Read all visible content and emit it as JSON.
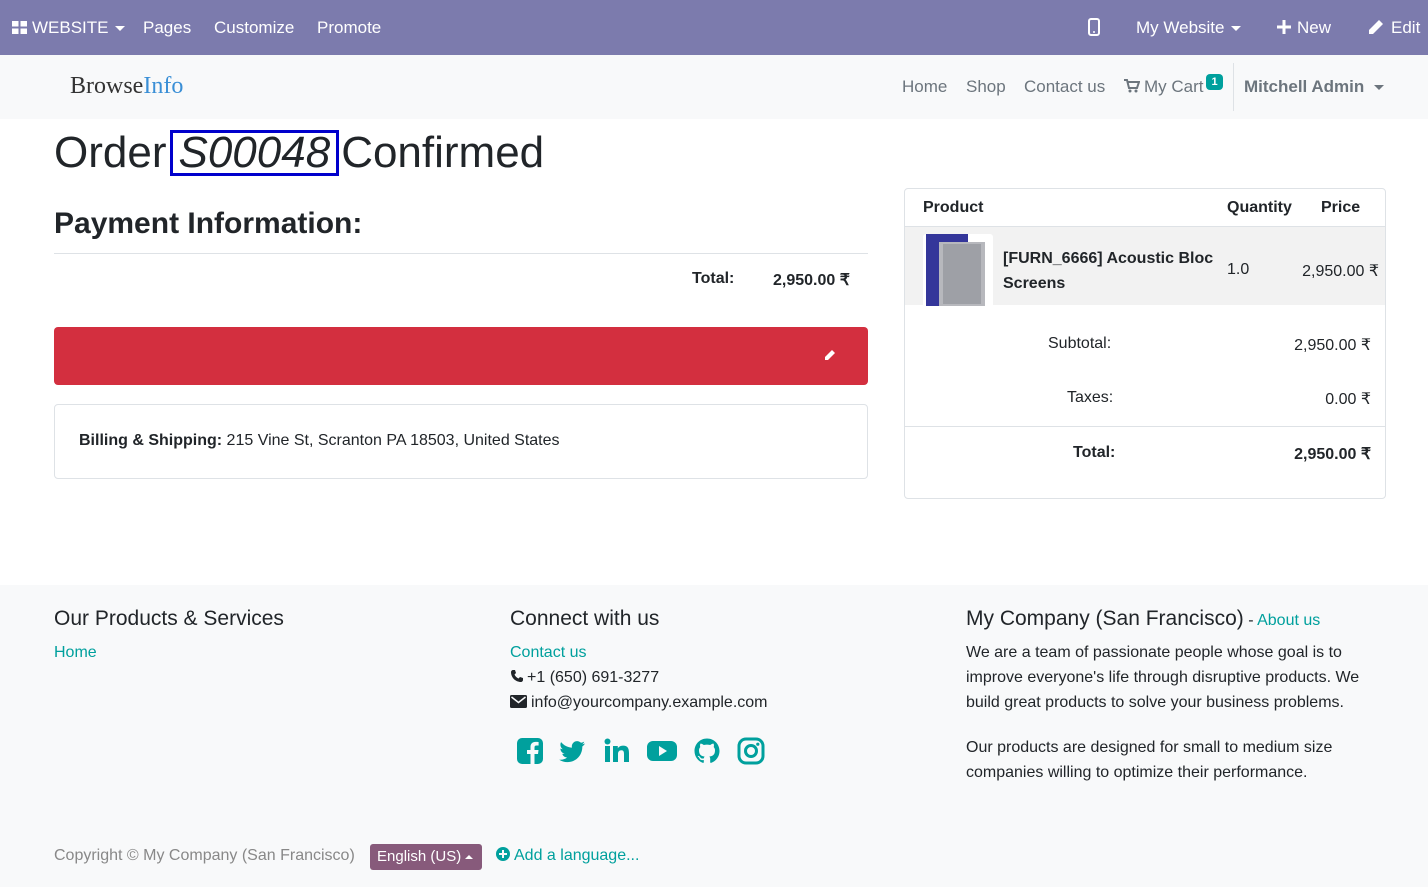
{
  "admin_bar": {
    "website_menu": "WEBSITE",
    "pages": "Pages",
    "customize": "Customize",
    "promote": "Promote",
    "website_selector": "My Website",
    "new": "New",
    "edit": "Edit"
  },
  "header": {
    "logo_part1": "Browse",
    "logo_part2": "Info",
    "nav": [
      "Home",
      "Shop",
      "Contact us"
    ],
    "cart_label": "My Cart",
    "cart_count": "1",
    "user": "Mitchell Admin"
  },
  "order": {
    "title_prefix": "Order",
    "number": "S00048",
    "title_suffix": "Confirmed",
    "payment_heading": "Payment Information:",
    "total_label": "Total:",
    "total_value": "2,950.00 ₹",
    "billing_label": "Billing & Shipping:",
    "billing_address": "215 Vine St, Scranton PA 18503, United States"
  },
  "summary": {
    "headers": {
      "product": "Product",
      "quantity": "Quantity",
      "price": "Price"
    },
    "line": {
      "name": "[FURN_6666] Acoustic Bloc Screens",
      "quantity": "1.0",
      "price": "2,950.00 ₹"
    },
    "subtotal_label": "Subtotal:",
    "subtotal_value": "2,950.00 ₹",
    "taxes_label": "Taxes:",
    "taxes_value": "0.00 ₹",
    "total_label": "Total:",
    "total_value": "2,950.00 ₹"
  },
  "footer": {
    "col1_heading": "Our Products & Services",
    "col1_link": "Home",
    "col2_heading": "Connect with us",
    "contact_link": "Contact us",
    "phone": "+1 (650) 691-3277",
    "email": "info@yourcompany.example.com",
    "col3_heading": "My Company (San Francisco)",
    "col3_sep": " - ",
    "about_link": "About us",
    "para1": "We are a team of passionate people whose goal is to improve everyone's life through disruptive products. We build great products to solve your business problems.",
    "para2": "Our products are designed for small to medium size companies willing to optimize their performance.",
    "copyright": "Copyright © My Company (San Francisco)",
    "language": "English (US)",
    "add_language": "Add a language..."
  },
  "colors": {
    "admin_bar": "#7c7bad",
    "accent": "#00a09d",
    "danger": "#d32f3f",
    "language_button": "#875a7b"
  },
  "icons": [
    "apps-grid-icon",
    "mobile-icon",
    "plus-icon",
    "pencil-icon",
    "cart-icon",
    "phone-icon",
    "envelope-icon",
    "facebook-icon",
    "twitter-icon",
    "linkedin-icon",
    "youtube-icon",
    "github-icon",
    "instagram-icon",
    "plus-circle-icon"
  ]
}
